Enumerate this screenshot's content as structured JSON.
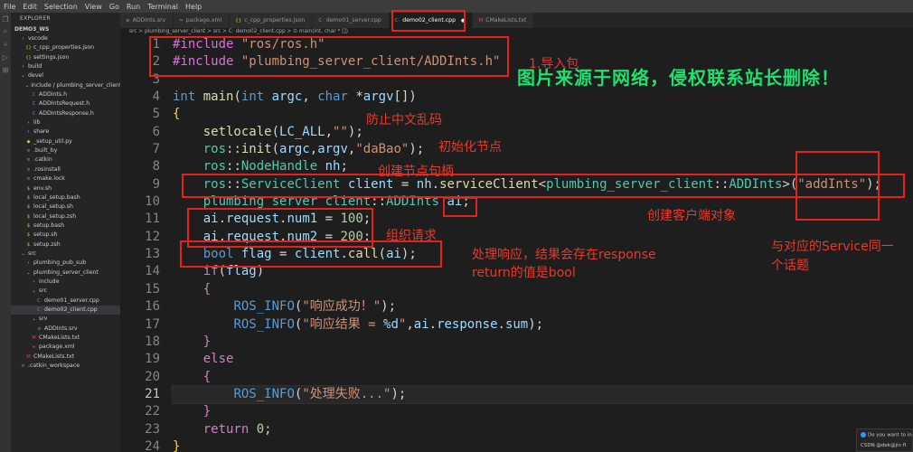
{
  "menubar": [
    "File",
    "Edit",
    "Selection",
    "View",
    "Go",
    "Run",
    "Terminal",
    "Help"
  ],
  "sidebar": {
    "title": "EXPLORER",
    "root": "DEMO3_WS",
    "items": [
      {
        "label": "vscode",
        "glyph": "›",
        "kind": "folder",
        "indent": 1
      },
      {
        "label": "c_cpp_properties.json",
        "glyph": "{}",
        "kind": "json",
        "indent": 2
      },
      {
        "label": "settings.json",
        "glyph": "{}",
        "kind": "json",
        "indent": 2
      },
      {
        "label": "build",
        "glyph": "›",
        "kind": "folder",
        "indent": 1
      },
      {
        "label": "devel",
        "glyph": "⌄",
        "kind": "folder",
        "indent": 1
      },
      {
        "label": "include / plumbing_server_client",
        "glyph": "⌄",
        "kind": "folder",
        "indent": 2
      },
      {
        "label": "ADDInts.h",
        "glyph": "C",
        "kind": "h",
        "indent": 3
      },
      {
        "label": "ADDIntsRequest.h",
        "glyph": "C",
        "kind": "h",
        "indent": 3
      },
      {
        "label": "ADDIntsResponse.h",
        "glyph": "C",
        "kind": "h",
        "indent": 3
      },
      {
        "label": "lib",
        "glyph": "›",
        "kind": "folder",
        "indent": 2
      },
      {
        "label": "share",
        "glyph": "›",
        "kind": "folder",
        "indent": 2
      },
      {
        "label": "_setup_util.py",
        "glyph": "◆",
        "kind": "py",
        "indent": 2
      },
      {
        "label": ".built_by",
        "glyph": "≡",
        "kind": "file",
        "indent": 2
      },
      {
        "label": ".catkin",
        "glyph": "≡",
        "kind": "file",
        "indent": 2
      },
      {
        "label": ".rosinstall",
        "glyph": "≡",
        "kind": "file",
        "indent": 2
      },
      {
        "label": "cmake.lock",
        "glyph": "≡",
        "kind": "file",
        "indent": 2
      },
      {
        "label": "env.sh",
        "glyph": "$",
        "kind": "sh",
        "indent": 2
      },
      {
        "label": "local_setup.bash",
        "glyph": "$",
        "kind": "sh",
        "indent": 2
      },
      {
        "label": "local_setup.sh",
        "glyph": "$",
        "kind": "sh",
        "indent": 2
      },
      {
        "label": "local_setup.zsh",
        "glyph": "$",
        "kind": "sh",
        "indent": 2
      },
      {
        "label": "setup.bash",
        "glyph": "$",
        "kind": "sh",
        "indent": 2
      },
      {
        "label": "setup.sh",
        "glyph": "$",
        "kind": "sh",
        "indent": 2
      },
      {
        "label": "setup.zsh",
        "glyph": "$",
        "kind": "sh",
        "indent": 2
      },
      {
        "label": "src",
        "glyph": "⌄",
        "kind": "folder",
        "indent": 1
      },
      {
        "label": "plumbing_pub_sub",
        "glyph": "›",
        "kind": "folder",
        "indent": 2
      },
      {
        "label": "plumbing_server_client",
        "glyph": "⌄",
        "kind": "folder",
        "indent": 2
      },
      {
        "label": "include",
        "glyph": "›",
        "kind": "folder",
        "indent": 3
      },
      {
        "label": "src",
        "glyph": "⌄",
        "kind": "folder",
        "indent": 3
      },
      {
        "label": "demo01_server.cpp",
        "glyph": "C·",
        "kind": "cpp",
        "indent": 4
      },
      {
        "label": "demo02_client.cpp",
        "glyph": "C·",
        "kind": "cpp",
        "indent": 4,
        "selected": true
      },
      {
        "label": "srv",
        "glyph": "⌄",
        "kind": "folder",
        "indent": 3
      },
      {
        "label": "ADDInts.srv",
        "glyph": "≡",
        "kind": "file",
        "indent": 4
      },
      {
        "label": "CMakeLists.txt",
        "glyph": "M",
        "kind": "cmake",
        "indent": 3
      },
      {
        "label": "package.xml",
        "glyph": "≈",
        "kind": "xml",
        "indent": 3
      },
      {
        "label": "CMakeLists.txt",
        "glyph": "M",
        "kind": "cmake",
        "indent": 2
      },
      {
        "label": ".catkin_workspace",
        "glyph": "≡",
        "kind": "file",
        "indent": 1
      }
    ]
  },
  "tabs": [
    {
      "label": "ADDInts.srv",
      "glyph": "≡",
      "kind": "file"
    },
    {
      "label": "package.xml",
      "glyph": "≈",
      "kind": "xml"
    },
    {
      "label": "c_cpp_properties.json",
      "glyph": "{}",
      "kind": "json"
    },
    {
      "label": "demo01_server.cpp",
      "glyph": "C·",
      "kind": "cpp"
    },
    {
      "label": "demo02_client.cpp",
      "glyph": "C·",
      "kind": "cpp",
      "active": true
    },
    {
      "label": "CMakeLists.txt",
      "glyph": "M",
      "kind": "cmake"
    }
  ],
  "breadcrumb": "src > plumbing_server_client > src > C· demo02_client.cpp > ⊙ main(int, char * [])",
  "editor": {
    "active_line": 21,
    "lines": [
      {
        "n": 1,
        "tokens": [
          [
            "pp",
            "#include"
          ],
          [
            "op",
            " "
          ],
          [
            "st",
            "\"ros/ros.h\""
          ]
        ]
      },
      {
        "n": 2,
        "tokens": [
          [
            "pp",
            "#include"
          ],
          [
            "op",
            " "
          ],
          [
            "st",
            "\"plumbing_server_client/ADDInts.h\""
          ]
        ]
      },
      {
        "n": 3,
        "tokens": []
      },
      {
        "n": 4,
        "tokens": [
          [
            "kw",
            "int"
          ],
          [
            "op",
            " "
          ],
          [
            "fn",
            "main"
          ],
          [
            "op",
            "("
          ],
          [
            "kw",
            "int"
          ],
          [
            "op",
            " "
          ],
          [
            "va",
            "argc"
          ],
          [
            "op",
            ", "
          ],
          [
            "kw",
            "char"
          ],
          [
            "op",
            " *"
          ],
          [
            "va",
            "argv"
          ],
          [
            "op",
            "[])"
          ]
        ]
      },
      {
        "n": 5,
        "tokens": [
          [
            "pn",
            "{"
          ]
        ]
      },
      {
        "n": 6,
        "tokens": [
          [
            "op",
            "    "
          ],
          [
            "fn",
            "setlocale"
          ],
          [
            "op",
            "("
          ],
          [
            "va",
            "LC_ALL"
          ],
          [
            "op",
            ","
          ],
          [
            "st",
            "\"\""
          ],
          [
            "op",
            ");"
          ]
        ]
      },
      {
        "n": 7,
        "tokens": [
          [
            "op",
            "    "
          ],
          [
            "ty",
            "ros"
          ],
          [
            "op",
            "::"
          ],
          [
            "fn",
            "init"
          ],
          [
            "op",
            "("
          ],
          [
            "va",
            "argc"
          ],
          [
            "op",
            ","
          ],
          [
            "va",
            "argv"
          ],
          [
            "op",
            ","
          ],
          [
            "st",
            "\"daBao\""
          ],
          [
            "op",
            ");"
          ]
        ]
      },
      {
        "n": 8,
        "tokens": [
          [
            "op",
            "    "
          ],
          [
            "ty",
            "ros"
          ],
          [
            "op",
            "::"
          ],
          [
            "ty",
            "NodeHandle"
          ],
          [
            "op",
            " "
          ],
          [
            "va",
            "nh"
          ],
          [
            "op",
            ";"
          ]
        ]
      },
      {
        "n": 9,
        "tokens": [
          [
            "op",
            "    "
          ],
          [
            "ty",
            "ros"
          ],
          [
            "op",
            "::"
          ],
          [
            "ty",
            "ServiceClient"
          ],
          [
            "op",
            " "
          ],
          [
            "va",
            "client"
          ],
          [
            "op",
            " = "
          ],
          [
            "va",
            "nh"
          ],
          [
            "op",
            "."
          ],
          [
            "fn",
            "serviceClient"
          ],
          [
            "op",
            "<"
          ],
          [
            "ty",
            "plumbing_server_client"
          ],
          [
            "op",
            "::"
          ],
          [
            "ty",
            "ADDInts"
          ],
          [
            "op",
            ">("
          ],
          [
            "st",
            "\"addInts\""
          ],
          [
            "op",
            ");"
          ]
        ]
      },
      {
        "n": 10,
        "tokens": [
          [
            "op",
            "    "
          ],
          [
            "ty",
            "plumbing_server_client"
          ],
          [
            "op",
            "::"
          ],
          [
            "ty",
            "ADDInts"
          ],
          [
            "op",
            " "
          ],
          [
            "va",
            "ai"
          ],
          [
            "op",
            ";"
          ]
        ]
      },
      {
        "n": 11,
        "tokens": [
          [
            "op",
            "    "
          ],
          [
            "va",
            "ai"
          ],
          [
            "op",
            "."
          ],
          [
            "va",
            "request"
          ],
          [
            "op",
            "."
          ],
          [
            "va",
            "num1"
          ],
          [
            "op",
            " = "
          ],
          [
            "nu",
            "100"
          ],
          [
            "op",
            ";"
          ]
        ]
      },
      {
        "n": 12,
        "tokens": [
          [
            "op",
            "    "
          ],
          [
            "va",
            "ai"
          ],
          [
            "op",
            "."
          ],
          [
            "va",
            "request"
          ],
          [
            "op",
            "."
          ],
          [
            "va",
            "num2"
          ],
          [
            "op",
            " = "
          ],
          [
            "nu",
            "200"
          ],
          [
            "op",
            ";"
          ]
        ]
      },
      {
        "n": 13,
        "tokens": [
          [
            "op",
            "    "
          ],
          [
            "kw",
            "bool"
          ],
          [
            "op",
            " "
          ],
          [
            "va",
            "flag"
          ],
          [
            "op",
            " = "
          ],
          [
            "va",
            "client"
          ],
          [
            "op",
            "."
          ],
          [
            "fn",
            "call"
          ],
          [
            "op",
            "("
          ],
          [
            "va",
            "ai"
          ],
          [
            "op",
            ");"
          ]
        ]
      },
      {
        "n": 14,
        "tokens": [
          [
            "op",
            "    "
          ],
          [
            "mc",
            "if"
          ],
          [
            "op",
            "("
          ],
          [
            "va",
            "flag"
          ],
          [
            "op",
            ")"
          ]
        ]
      },
      {
        "n": 15,
        "tokens": [
          [
            "op",
            "    "
          ],
          [
            "mc",
            "{"
          ]
        ]
      },
      {
        "n": 16,
        "tokens": [
          [
            "op",
            "        "
          ],
          [
            "kw",
            "ROS_INFO"
          ],
          [
            "op",
            "("
          ],
          [
            "st",
            "\"响应成功！\""
          ],
          [
            "op",
            ");"
          ]
        ]
      },
      {
        "n": 17,
        "tokens": [
          [
            "op",
            "        "
          ],
          [
            "kw",
            "ROS_INFO"
          ],
          [
            "op",
            "("
          ],
          [
            "st",
            "\"响应结果 = "
          ],
          [
            "va",
            "%d"
          ],
          [
            "st",
            "\""
          ],
          [
            "op",
            ","
          ],
          [
            "va",
            "ai"
          ],
          [
            "op",
            "."
          ],
          [
            "va",
            "response"
          ],
          [
            "op",
            "."
          ],
          [
            "va",
            "sum"
          ],
          [
            "op",
            ");"
          ]
        ]
      },
      {
        "n": 18,
        "tokens": [
          [
            "op",
            "    "
          ],
          [
            "mc",
            "}"
          ]
        ]
      },
      {
        "n": 19,
        "tokens": [
          [
            "op",
            "    "
          ],
          [
            "mc",
            "else"
          ]
        ]
      },
      {
        "n": 20,
        "tokens": [
          [
            "op",
            "    "
          ],
          [
            "mc",
            "{"
          ]
        ]
      },
      {
        "n": 21,
        "tokens": [
          [
            "op",
            "        "
          ],
          [
            "kw",
            "ROS_INFO"
          ],
          [
            "op",
            "("
          ],
          [
            "st",
            "\"处理失败...\""
          ],
          [
            "op",
            ");"
          ]
        ]
      },
      {
        "n": 22,
        "tokens": [
          [
            "op",
            "    "
          ],
          [
            "mc",
            "}"
          ]
        ]
      },
      {
        "n": 23,
        "tokens": [
          [
            "op",
            "    "
          ],
          [
            "mc",
            "return"
          ],
          [
            "op",
            " "
          ],
          [
            "nu",
            "0"
          ],
          [
            "op",
            ";"
          ]
        ]
      },
      {
        "n": 24,
        "tokens": [
          [
            "pn",
            "}"
          ]
        ]
      }
    ]
  },
  "annotations": {
    "import": "1.导入包",
    "setlocale": "防止中文乱码",
    "init": "初始化节点",
    "nodehandle": "创建节点句柄",
    "client": "创建客户端对象",
    "request": "组织请求",
    "response_line1": "处理响应，结果会存在response",
    "response_line2": "return的值是bool",
    "topic_line1": "与对应的Service同一",
    "topic_line2": "个话题"
  },
  "watermark": "图片来源于网络，侵权联系站长删除！",
  "toast": {
    "line1": "Do you want to in",
    "line2": "CSDN @dek@jin fl"
  },
  "colors": {
    "annotation_red": "#e0231e",
    "watermark_green": "#1fe06f",
    "editor_bg": "#1e1e1e",
    "sidebar_bg": "#252526"
  }
}
